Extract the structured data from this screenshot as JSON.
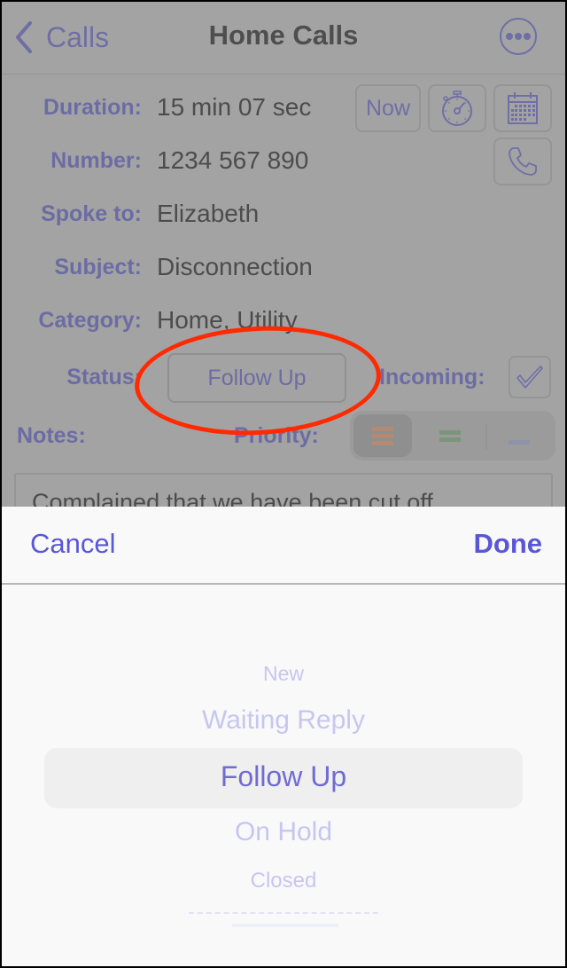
{
  "nav": {
    "back_label": "Calls",
    "title": "Home Calls",
    "back_icon": "chevron-left-icon",
    "more_icon": "ellipsis-circle-icon"
  },
  "form": {
    "duration": {
      "label": "Duration:",
      "value": "15 min 07 sec"
    },
    "number": {
      "label": "Number:",
      "value": "1234 567 890"
    },
    "spoke_to": {
      "label": "Spoke to:",
      "value": "Elizabeth"
    },
    "subject": {
      "label": "Subject:",
      "value": "Disconnection"
    },
    "category": {
      "label": "Category:",
      "value": "Home, Utility"
    },
    "status": {
      "label": "Status:",
      "value": "Follow Up"
    },
    "incoming": {
      "label": "Incoming:",
      "checked": true
    },
    "notes": {
      "label": "Notes:",
      "value": "Complained that we have been cut off"
    },
    "priority": {
      "label": "Priority:",
      "options": [
        {
          "name": "high",
          "color": "#b38a73",
          "selected": true
        },
        {
          "name": "medium",
          "color": "#7a957a",
          "selected": false
        },
        {
          "name": "low",
          "color": "#8e93aa",
          "selected": false
        }
      ]
    },
    "buttons": {
      "now_label": "Now",
      "timer_icon": "stopwatch-icon",
      "calendar_icon": "calendar-icon",
      "phone_icon": "phone-icon"
    }
  },
  "annotation": {
    "color": "#ff2a00",
    "target": "status-button"
  },
  "picker": {
    "cancel_label": "Cancel",
    "done_label": "Done",
    "options": [
      "New",
      "Waiting Reply",
      "Follow Up",
      "On Hold",
      "Closed"
    ],
    "selected": "Follow Up",
    "accent_color": "#5a57d6"
  }
}
